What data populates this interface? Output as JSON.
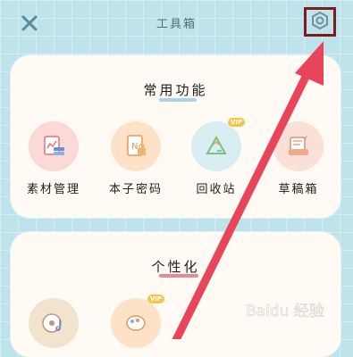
{
  "header": {
    "title": "工具箱"
  },
  "section_common": {
    "title": "常用功能",
    "items": [
      {
        "label": "素材管理",
        "icon": "material-manage-icon"
      },
      {
        "label": "本子密码",
        "icon": "notebook-password-icon"
      },
      {
        "label": "回收站",
        "icon": "recycle-bin-icon",
        "badge": "VIP"
      },
      {
        "label": "草稿箱",
        "icon": "draft-box-icon"
      }
    ]
  },
  "section_personal": {
    "title": "个性化",
    "items": [
      {
        "icon": "music-disc-icon"
      },
      {
        "icon": "theme-icon",
        "badge": "VIP"
      }
    ]
  },
  "watermark": {
    "text": "Baidu 经验"
  },
  "colors": {
    "accent": "#e8445a",
    "highlight_box": "#7b1c22",
    "background": "#bfe3ea",
    "card": "#fffaf4"
  }
}
